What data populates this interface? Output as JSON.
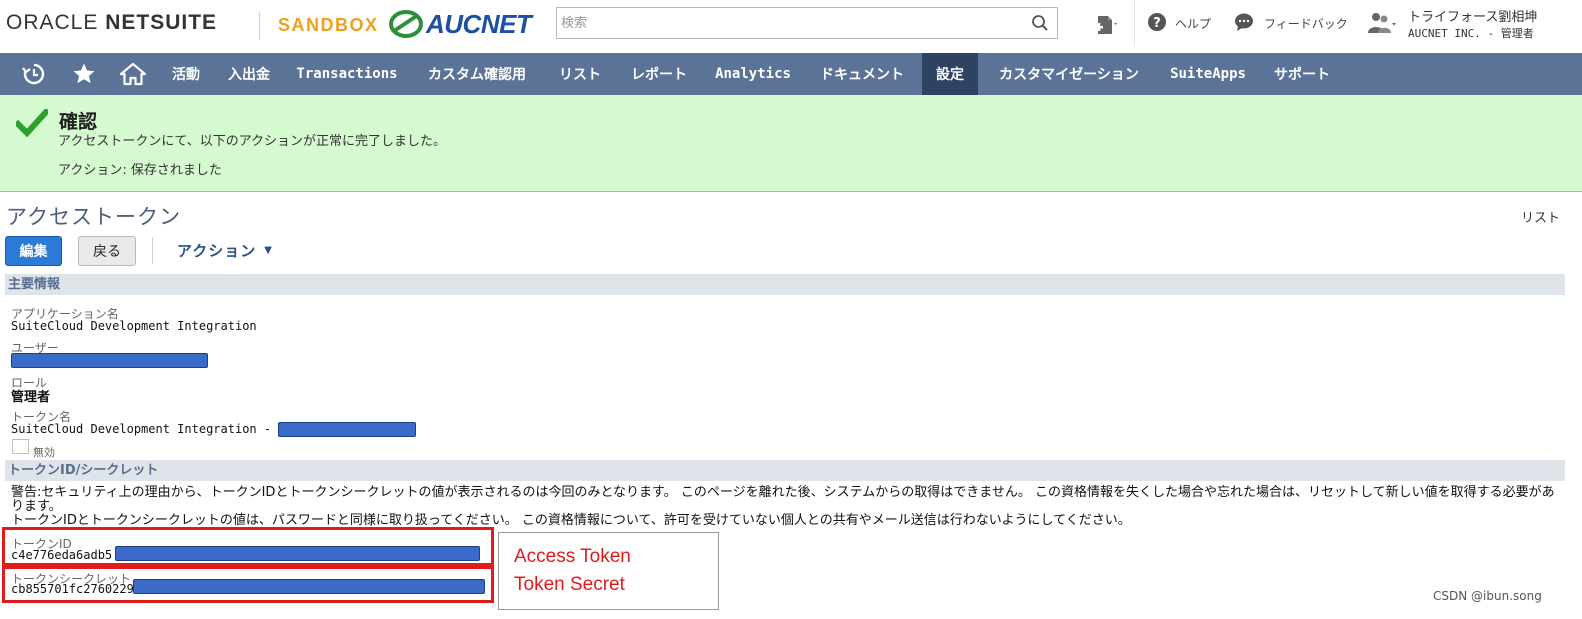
{
  "header": {
    "brand_oracle": "ORACLE",
    "brand_netsuite": "NETSUITE",
    "env_badge": "SANDBOX",
    "company_logo": "AUCNET",
    "search_placeholder": "検索",
    "help_label": "ヘルプ",
    "feedback_label": "フィードバック",
    "user_name": "トライフォース劉相坤",
    "user_company_role": "AUCNET INC. - 管理者"
  },
  "nav": {
    "items": [
      {
        "label": "活動"
      },
      {
        "label": "入出金"
      },
      {
        "label": "Transactions"
      },
      {
        "label": "カスタム確認用"
      },
      {
        "label": "リスト"
      },
      {
        "label": "レポート"
      },
      {
        "label": "Analytics"
      },
      {
        "label": "ドキュメント"
      },
      {
        "label": "設定"
      },
      {
        "label": "カスタマイゼーション"
      },
      {
        "label": "SuiteApps"
      },
      {
        "label": "サポート"
      }
    ],
    "active": "設定"
  },
  "confirm": {
    "title": "確認",
    "message": "アクセストークンにて、以下のアクションが正常に完了しました。",
    "action_line": "アクション: 保存されました"
  },
  "page": {
    "title": "アクセストークン",
    "list_link": "リスト",
    "edit_button": "編集",
    "back_button": "戻る",
    "action_menu": "アクション"
  },
  "primary_info": {
    "section_title": "主要情報",
    "app_name_label": "アプリケーション名",
    "app_name_value": "SuiteCloud Development Integration",
    "user_label": "ユーザー",
    "role_label": "ロール",
    "role_value": "管理者",
    "token_name_label": "トークン名",
    "token_name_value": "SuiteCloud Development Integration -",
    "inactive_label": "無効"
  },
  "token_section": {
    "section_title": "トークンID/シークレット",
    "warning_line1": "警告:セキュリティ上の理由から、トークンIDとトークンシークレットの値が表示されるのは今回のみとなります。 このページを離れた後、システムからの取得はできません。 この資格情報を失くした場合や忘れた場合は、リセットして新しい値を取得する必要があります。",
    "warning_line2": "トークンIDとトークンシークレットの値は、パスワードと同様に取り扱ってください。 この資格情報について、許可を受けていない個人との共有やメール送信は行わないようにしてください。",
    "token_id_label": "トークンID",
    "token_id_value": "c4e776eda6adb5",
    "token_secret_label": "トークンシークレット",
    "token_secret_value": "cb855701fc2760229"
  },
  "annotation": {
    "line1": "Access Token",
    "line2": "Token Secret"
  },
  "watermark": "CSDN @ibun.song",
  "colors": {
    "nav_bg": "#5b7396",
    "nav_active": "#2e4261",
    "confirm_bg": "#d6fad0",
    "edit_button": "#2b7bd6",
    "redaction": "#3a6bc8",
    "annotation_red": "#e01b1b"
  }
}
